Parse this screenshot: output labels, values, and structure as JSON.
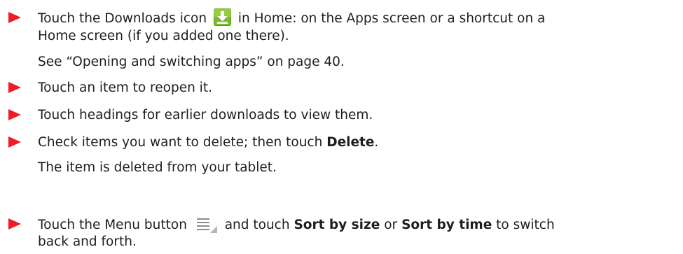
{
  "bullets": [
    {
      "line1_before_icon": "Touch the Downloads icon",
      "line1_after_icon": "in Home: on the Apps screen or a shortcut on a",
      "line2": "Home screen (if you added one there).",
      "note": "See “Opening and switching apps” on page 40.",
      "icon": "downloads-app-icon"
    },
    {
      "text": "Touch an item to reopen it."
    },
    {
      "text": "Touch headings for earlier downloads to view them."
    },
    {
      "text_before": "Check items you want to delete; then touch",
      "bold": "Delete",
      "text_after": ".",
      "note": "The item is deleted from your tablet."
    },
    {
      "text_before": "Touch the Menu button",
      "icon": "menu-button-icon",
      "text_mid1": "and touch",
      "bold1": "Sort by size",
      "text_mid2": "or",
      "bold2": "Sort by time",
      "text_after": "to switch",
      "line2": "back and forth."
    }
  ],
  "colors": {
    "bullet_arrow": "#ee1c25",
    "text": "#1e1e1e",
    "download_icon_green": "#7cbb2f"
  }
}
